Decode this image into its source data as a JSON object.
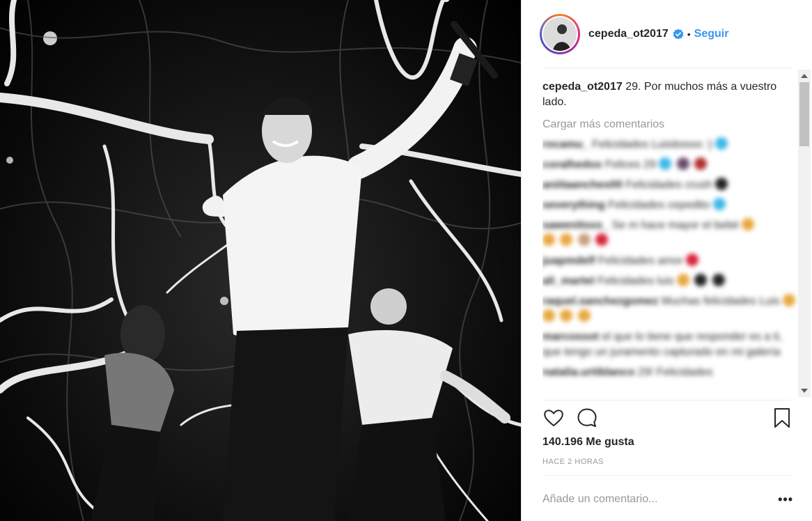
{
  "post": {
    "username": "cepeda_ot2017",
    "follow_label": "Seguir",
    "separator": "•",
    "caption_text": "29. Por muchos más a vuestro lado.",
    "load_more_label": "Cargar más comentarios",
    "likes": "140.196 Me gusta",
    "timestamp": "HACE 2 HORAS",
    "comment_placeholder": "Añade un comentario...",
    "more_label": "•••"
  },
  "comments": [
    {
      "user": "rocamu_",
      "text": "Felicidades Luisitoooo :)"
    },
    {
      "user": "coralhedox",
      "text": "Felices 29"
    },
    {
      "user": "aniitaanches00",
      "text": "Felicidades crush"
    },
    {
      "user": "severything",
      "text": "Felicidades cepedito"
    },
    {
      "user": "sawenitoxx_",
      "text": "Se m hace mayor el bebé"
    },
    {
      "user": "juapmdelf",
      "text": "Felicidades amor"
    },
    {
      "user": "ali_martel",
      "text": "Felicidades luis"
    },
    {
      "user": "raquel.sanchezgomez",
      "text": "Muchas felicidades Luis"
    },
    {
      "user": "marcossot",
      "text": "el que lo tiene que responder es a ti, que tengo un juramento capturado en mi galería"
    },
    {
      "user": "natalia.urtiblanco",
      "text": "29! Felicidades"
    }
  ],
  "colors": {
    "accent": "#3897f0",
    "muted": "#999999",
    "text": "#262626"
  },
  "icons": {
    "like": "heart-outline-icon",
    "comment": "speech-bubble-icon",
    "save": "bookmark-icon",
    "verified": "verified-badge-icon"
  }
}
